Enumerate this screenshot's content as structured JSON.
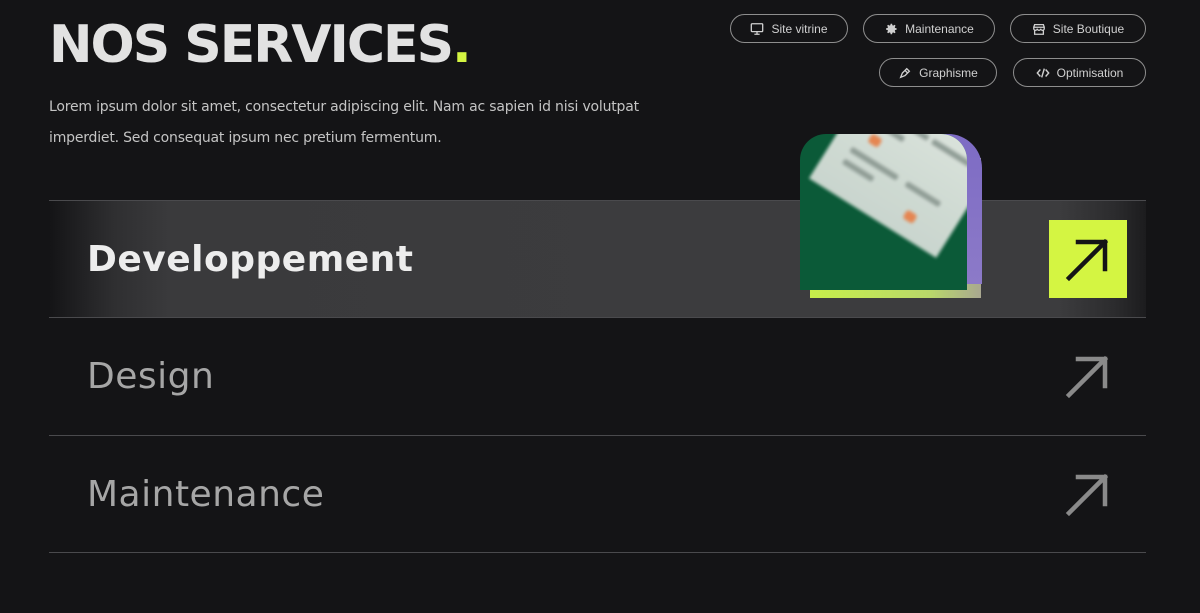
{
  "header": {
    "title": "NOS SERVICES",
    "title_dot": ".",
    "intro": "Lorem ipsum dolor sit amet, consectetur adipiscing elit. Nam ac sapien id nisi volutpat imperdiet. Sed consequat ipsum nec pretium fermentum."
  },
  "tags": [
    {
      "label": "Site vitrine",
      "icon": "monitor-icon"
    },
    {
      "label": "Maintenance",
      "icon": "gear-icon"
    },
    {
      "label": "Site Boutique",
      "icon": "store-icon"
    },
    {
      "label": "Graphisme",
      "icon": "pen-icon"
    },
    {
      "label": "Optimisation",
      "icon": "code-icon"
    }
  ],
  "services": [
    {
      "label": "Developpement",
      "active": true
    },
    {
      "label": "Design",
      "active": false
    },
    {
      "label": "Maintenance",
      "active": false
    }
  ],
  "colors": {
    "accent": "#d4f542",
    "background": "#141416",
    "active_row": "#3c3c3e",
    "card_green": "#0b5a38",
    "card_purple": "#7d6bc4"
  }
}
